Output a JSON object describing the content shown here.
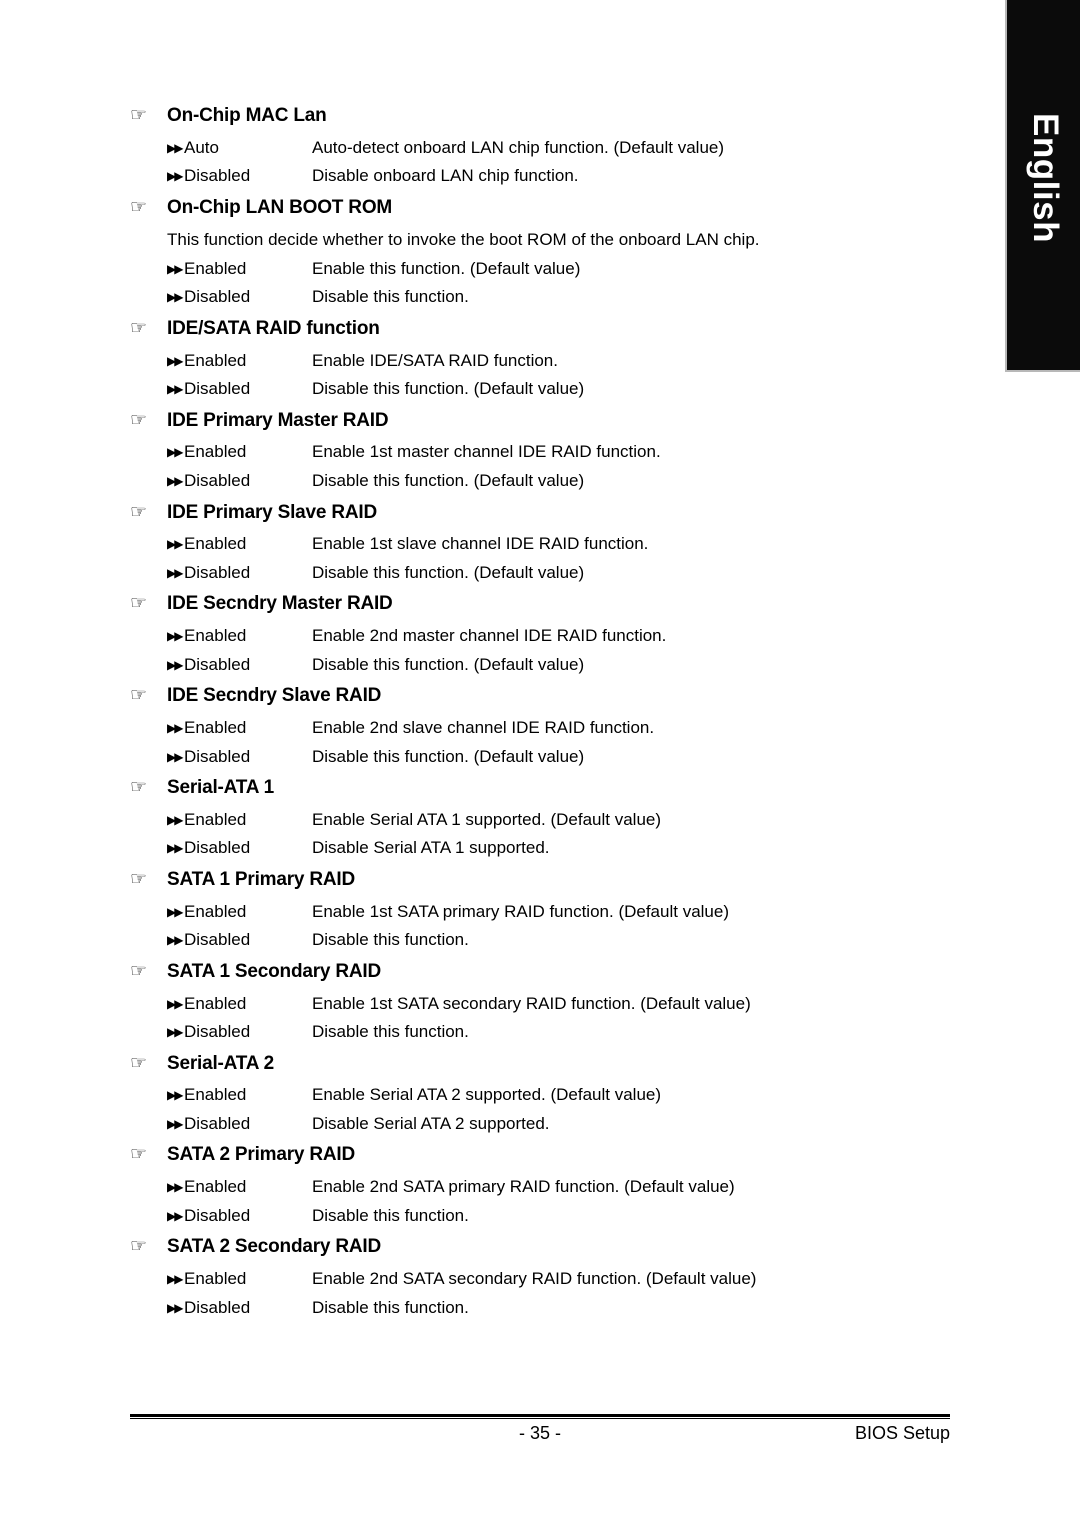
{
  "page": {
    "language_tab": "English",
    "heading_marker_icon": "pointing-hand-icon",
    "option_marker_icon": "double-chevron-right-icon"
  },
  "sections": [
    {
      "title": "On-Chip MAC Lan",
      "note": "",
      "options": [
        {
          "label": "Auto",
          "desc": "Auto-detect onboard LAN chip function. (Default value)"
        },
        {
          "label": "Disabled",
          "desc": "Disable onboard LAN chip function."
        }
      ]
    },
    {
      "title": "On-Chip LAN BOOT ROM",
      "note": "This function decide whether to invoke the boot ROM of the onboard LAN chip.",
      "options": [
        {
          "label": "Enabled",
          "desc": "Enable this function. (Default value)"
        },
        {
          "label": "Disabled",
          "desc": "Disable this function."
        }
      ]
    },
    {
      "title": "IDE/SATA RAID function",
      "note": "",
      "options": [
        {
          "label": "Enabled",
          "desc": "Enable IDE/SATA RAID function."
        },
        {
          "label": "Disabled",
          "desc": "Disable this function. (Default value)"
        }
      ]
    },
    {
      "title": "IDE Primary Master RAID",
      "note": "",
      "options": [
        {
          "label": "Enabled",
          "desc": "Enable 1st master channel IDE RAID function."
        },
        {
          "label": "Disabled",
          "desc": "Disable this function. (Default value)"
        }
      ]
    },
    {
      "title": "IDE Primary Slave RAID",
      "note": "",
      "options": [
        {
          "label": "Enabled",
          "desc": "Enable 1st slave channel IDE RAID function."
        },
        {
          "label": "Disabled",
          "desc": "Disable this function. (Default value)"
        }
      ]
    },
    {
      "title": "IDE Secndry Master RAID",
      "note": "",
      "options": [
        {
          "label": "Enabled",
          "desc": "Enable 2nd master channel IDE RAID function."
        },
        {
          "label": "Disabled",
          "desc": "Disable this function. (Default value)"
        }
      ]
    },
    {
      "title": "IDE Secndry Slave RAID",
      "note": "",
      "options": [
        {
          "label": "Enabled",
          "desc": "Enable 2nd slave channel IDE RAID function."
        },
        {
          "label": "Disabled",
          "desc": "Disable this function. (Default value)"
        }
      ]
    },
    {
      "title": "Serial-ATA 1",
      "note": "",
      "options": [
        {
          "label": "Enabled",
          "desc": "Enable Serial ATA 1 supported. (Default value)"
        },
        {
          "label": "Disabled",
          "desc": "Disable Serial ATA 1 supported."
        }
      ]
    },
    {
      "title": "SATA 1 Primary RAID",
      "note": "",
      "options": [
        {
          "label": "Enabled",
          "desc": "Enable 1st SATA primary RAID function. (Default value)"
        },
        {
          "label": "Disabled",
          "desc": "Disable this function."
        }
      ]
    },
    {
      "title": "SATA 1 Secondary RAID",
      "note": "",
      "options": [
        {
          "label": "Enabled",
          "desc": "Enable 1st SATA secondary RAID function. (Default value)"
        },
        {
          "label": "Disabled",
          "desc": "Disable this function."
        }
      ]
    },
    {
      "title": "Serial-ATA 2",
      "note": "",
      "options": [
        {
          "label": "Enabled",
          "desc": "Enable Serial ATA 2 supported. (Default value)"
        },
        {
          "label": "Disabled",
          "desc": "Disable Serial ATA 2 supported."
        }
      ]
    },
    {
      "title": "SATA 2 Primary RAID",
      "note": "",
      "options": [
        {
          "label": "Enabled",
          "desc": "Enable 2nd SATA primary RAID function. (Default value)"
        },
        {
          "label": "Disabled",
          "desc": "Disable this function."
        }
      ]
    },
    {
      "title": "SATA 2 Secondary RAID",
      "note": "",
      "options": [
        {
          "label": "Enabled",
          "desc": "Enable 2nd SATA secondary RAID function. (Default value)"
        },
        {
          "label": "Disabled",
          "desc": "Disable this function."
        }
      ]
    }
  ],
  "footer": {
    "page_number": "- 35 -",
    "right_label": "BIOS Setup"
  }
}
